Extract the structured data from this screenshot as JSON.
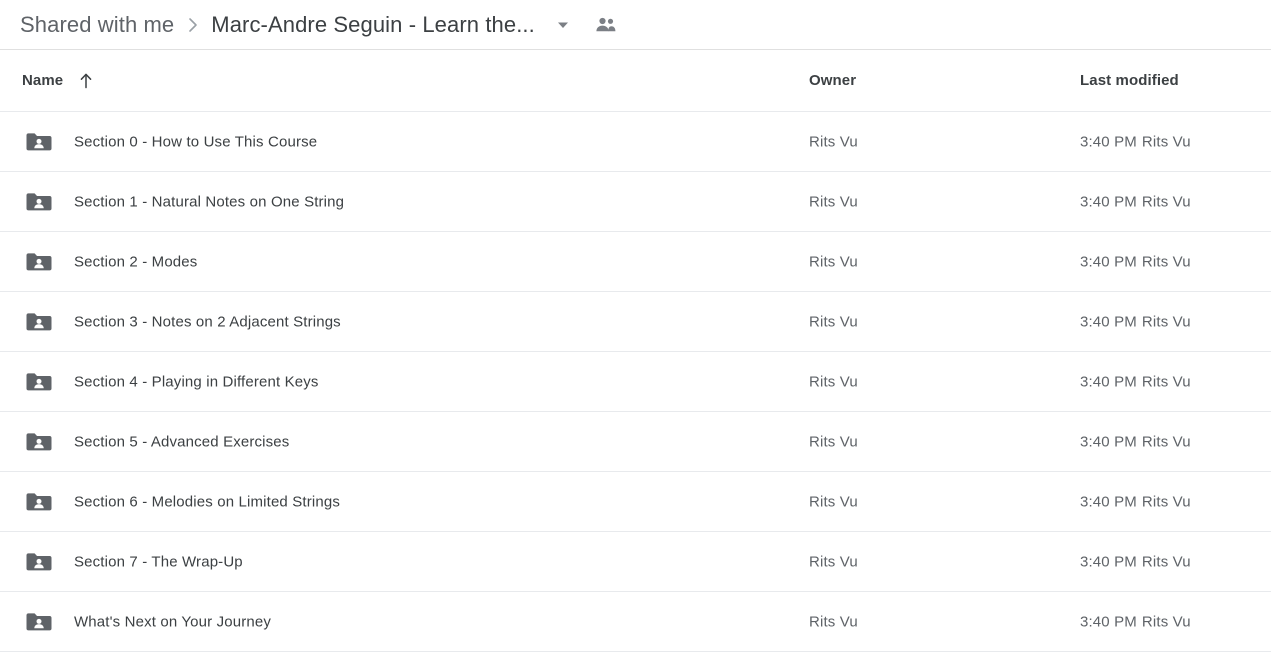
{
  "breadcrumb": {
    "parent_label": "Shared with me",
    "separator": "›",
    "current_label": "Marc-Andre Seguin - Learn the...",
    "caret_icon": "chevron-down-icon",
    "people_icon": "people-shared-icon"
  },
  "columns": {
    "name": "Name",
    "owner": "Owner",
    "last_modified": "Last modified",
    "sort_icon": "arrow-up-icon",
    "sort_direction": "ascending"
  },
  "colors": {
    "folder_icon": "#5f6368",
    "primary_text": "#3c4043",
    "secondary_text": "#5f6368",
    "divider": "#e8eaed"
  },
  "rows": [
    {
      "icon": "shared-folder-icon",
      "name": "Section 0 - How to Use This Course",
      "owner": "Rits Vu",
      "modified_time": "3:40 PM",
      "modified_by": "Rits Vu"
    },
    {
      "icon": "shared-folder-icon",
      "name": "Section 1 - Natural Notes on One String",
      "owner": "Rits Vu",
      "modified_time": "3:40 PM",
      "modified_by": "Rits Vu"
    },
    {
      "icon": "shared-folder-icon",
      "name": "Section 2 - Modes",
      "owner": "Rits Vu",
      "modified_time": "3:40 PM",
      "modified_by": "Rits Vu"
    },
    {
      "icon": "shared-folder-icon",
      "name": "Section 3 - Notes on 2 Adjacent Strings",
      "owner": "Rits Vu",
      "modified_time": "3:40 PM",
      "modified_by": "Rits Vu"
    },
    {
      "icon": "shared-folder-icon",
      "name": "Section 4 - Playing in Different Keys",
      "owner": "Rits Vu",
      "modified_time": "3:40 PM",
      "modified_by": "Rits Vu"
    },
    {
      "icon": "shared-folder-icon",
      "name": "Section 5 - Advanced Exercises",
      "owner": "Rits Vu",
      "modified_time": "3:40 PM",
      "modified_by": "Rits Vu"
    },
    {
      "icon": "shared-folder-icon",
      "name": "Section 6 - Melodies on Limited Strings",
      "owner": "Rits Vu",
      "modified_time": "3:40 PM",
      "modified_by": "Rits Vu"
    },
    {
      "icon": "shared-folder-icon",
      "name": "Section 7 - The Wrap-Up",
      "owner": "Rits Vu",
      "modified_time": "3:40 PM",
      "modified_by": "Rits Vu"
    },
    {
      "icon": "shared-folder-icon",
      "name": "What's Next on Your Journey",
      "owner": "Rits Vu",
      "modified_time": "3:40 PM",
      "modified_by": "Rits Vu"
    }
  ]
}
